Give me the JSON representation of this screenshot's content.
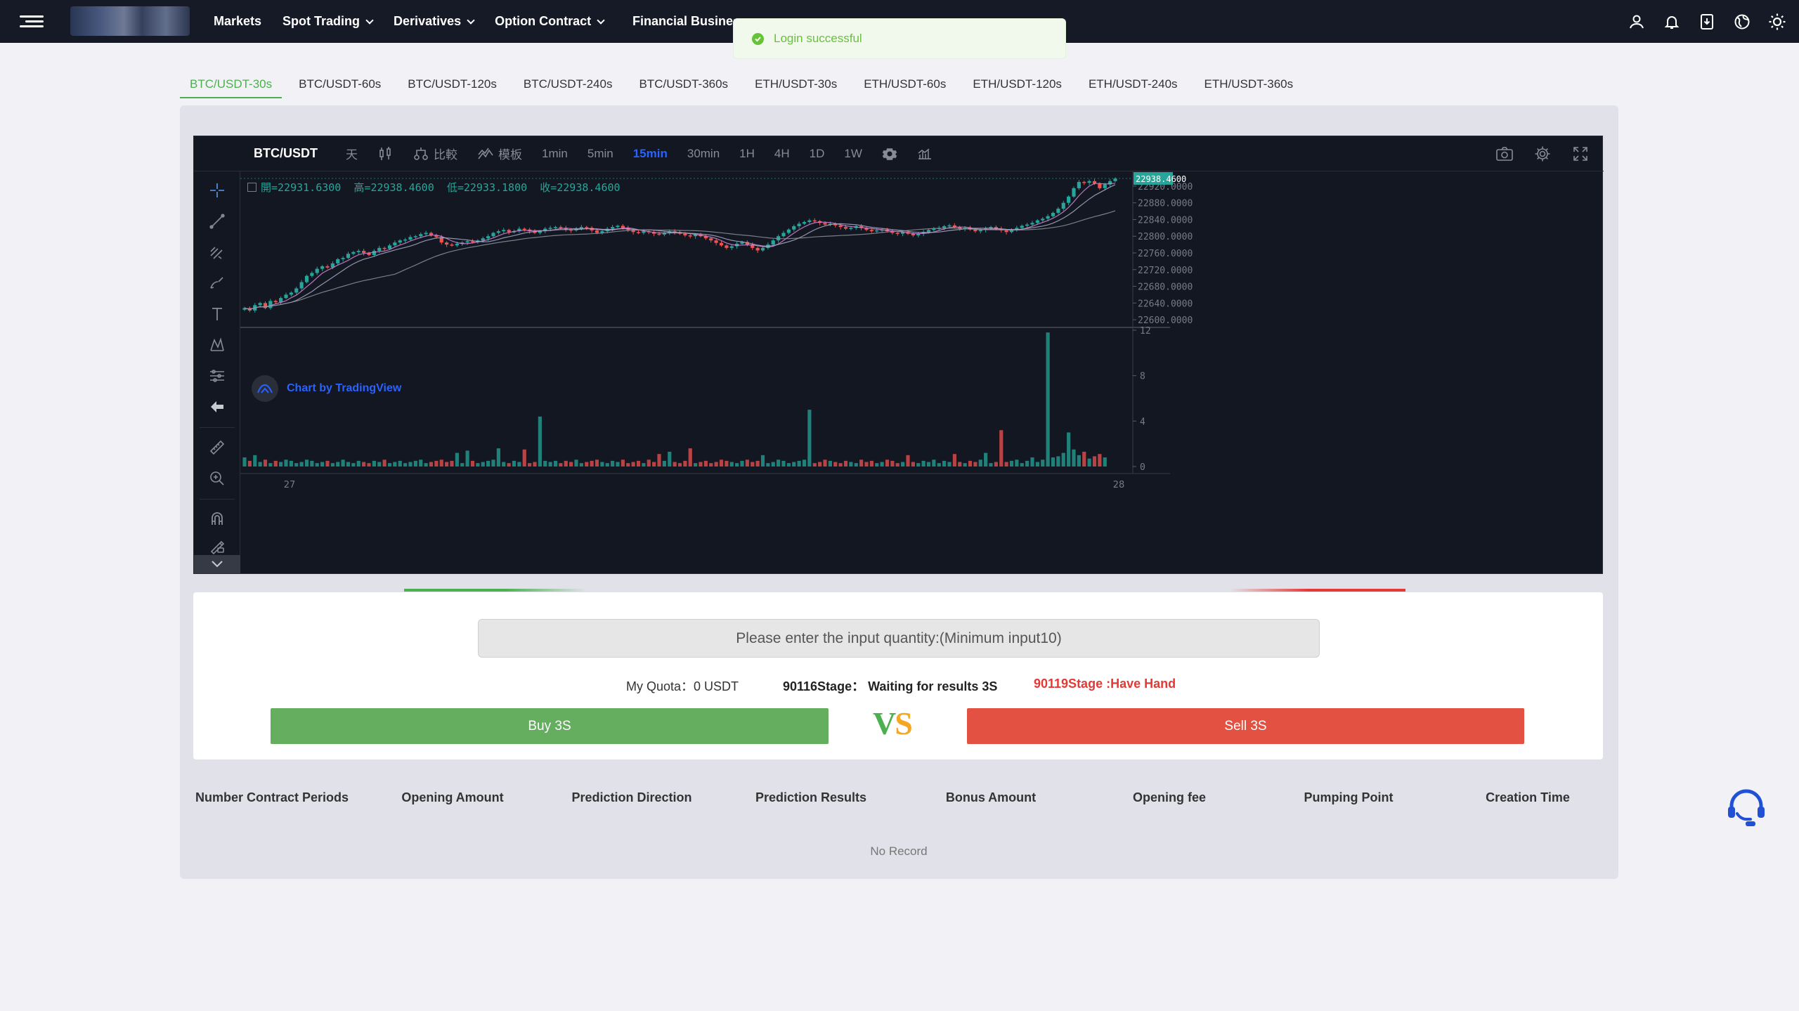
{
  "header": {
    "nav": [
      {
        "label": "Markets",
        "has_dropdown": false
      },
      {
        "label": "Spot Trading",
        "has_dropdown": true
      },
      {
        "label": "Derivatives",
        "has_dropdown": true
      },
      {
        "label": "Option Contract",
        "has_dropdown": true
      }
    ],
    "nav_clipped": "Financial Business",
    "icons": [
      "user-icon",
      "bell-icon",
      "download-icon",
      "globe-icon",
      "sun-icon"
    ]
  },
  "toast": {
    "message": "Login successful",
    "color": "#67c23a"
  },
  "tabs": {
    "items": [
      "BTC/USDT-30s",
      "BTC/USDT-60s",
      "BTC/USDT-120s",
      "BTC/USDT-240s",
      "BTC/USDT-360s",
      "ETH/USDT-30s",
      "ETH/USDT-60s",
      "ETH/USDT-120s",
      "ETH/USDT-240s",
      "ETH/USDT-360s"
    ],
    "active_index": 0
  },
  "chart": {
    "symbol": "BTC/USDT",
    "toolbar": {
      "day": "天",
      "compare": "比較",
      "template": "模板",
      "intervals": [
        "1min",
        "5min",
        "15min",
        "30min",
        "1H",
        "4H",
        "1D",
        "1W"
      ],
      "active_interval": "15min"
    },
    "ohlc": {
      "open_label": "開=",
      "open": "22931.6300",
      "high_label": "高=",
      "high": "22938.4600",
      "low_label": "低=",
      "low": "22933.1800",
      "close_label": "收=",
      "close": "22938.4600"
    },
    "branding": "Chart by TradingView",
    "colors": {
      "up": "#26a69a",
      "down": "#ef5350",
      "background": "#131722",
      "active": "#2962ff"
    }
  },
  "chart_data": {
    "type": "candlestick",
    "title": "BTC/USDT",
    "interval": "15min",
    "price_axis": {
      "ticks": [
        "22920.0000",
        "22880.0000",
        "22840.0000",
        "22800.0000",
        "22760.0000",
        "22720.0000",
        "22680.0000",
        "22640.0000",
        "22600.0000"
      ],
      "last_price": "22938.4600",
      "ylim": [
        22585,
        22935
      ]
    },
    "volume_axis": {
      "ticks": [
        "12",
        "8",
        "4",
        "0"
      ],
      "ylim": [
        0,
        12
      ]
    },
    "x_ticks": [
      "27",
      "28"
    ],
    "close_series": [
      22628,
      22622,
      22635,
      22640,
      22628,
      22645,
      22642,
      22652,
      22660,
      22665,
      22675,
      22690,
      22705,
      22712,
      22722,
      22728,
      22725,
      22735,
      22745,
      22748,
      22758,
      22762,
      22765,
      22760,
      22755,
      22765,
      22772,
      22770,
      22778,
      22785,
      22790,
      22792,
      22798,
      22800,
      22805,
      22808,
      22802,
      22798,
      22785,
      22780,
      22778,
      22782,
      22785,
      22788,
      22786,
      22790,
      22795,
      22800,
      22808,
      22812,
      22815,
      22810,
      22812,
      22818,
      22816,
      22812,
      22808,
      22812,
      22818,
      22820,
      22822,
      22820,
      22816,
      22814,
      22818,
      22822,
      22820,
      22814,
      22808,
      22812,
      22818,
      22822,
      22825,
      22820,
      22815,
      22810,
      22808,
      22812,
      22810,
      22806,
      22804,
      22808,
      22812,
      22810,
      22806,
      22802,
      22800,
      22804,
      22800,
      22795,
      22790,
      22784,
      22778,
      22772,
      22776,
      22782,
      22786,
      22780,
      22772,
      22766,
      22772,
      22780,
      22790,
      22800,
      22808,
      22816,
      22824,
      22830,
      22834,
      22838,
      22836,
      22832,
      22828,
      22830,
      22826,
      22822,
      22818,
      22820,
      22824,
      22820,
      22815,
      22812,
      22814,
      22816,
      22812,
      22808,
      22806,
      22810,
      22806,
      22802,
      22806,
      22810,
      22815,
      22818,
      22820,
      22824,
      22826,
      22822,
      22818,
      22820,
      22816,
      22812,
      22815,
      22818,
      22822,
      22818,
      22814,
      22810,
      22815,
      22820,
      22825,
      22828,
      22832,
      22838,
      22842,
      22848,
      22856,
      22866,
      22880,
      22895,
      22915,
      22930,
      22928,
      22932,
      22926,
      22915,
      22924,
      22932,
      22938
    ],
    "volume_series": [
      0.8,
      0.5,
      1.0,
      0.4,
      0.6,
      0.3,
      0.5,
      0.4,
      0.6,
      0.5,
      0.3,
      0.4,
      0.6,
      0.5,
      0.3,
      0.4,
      0.5,
      0.3,
      0.4,
      0.6,
      0.4,
      0.3,
      0.5,
      0.4,
      0.3,
      0.5,
      0.4,
      0.6,
      0.3,
      0.4,
      0.5,
      0.3,
      0.4,
      0.5,
      0.6,
      0.3,
      0.4,
      0.5,
      0.6,
      0.4,
      0.5,
      1.2,
      0.3,
      1.4,
      0.5,
      0.3,
      0.4,
      0.5,
      0.6,
      1.6,
      0.4,
      0.3,
      0.5,
      0.4,
      1.5,
      0.3,
      0.4,
      4.4,
      0.5,
      0.4,
      0.5,
      0.3,
      0.5,
      0.4,
      0.6,
      0.3,
      0.4,
      0.5,
      0.6,
      0.4,
      0.3,
      0.5,
      0.4,
      0.6,
      0.3,
      0.4,
      0.5,
      0.3,
      0.6,
      0.4,
      1.1,
      0.5,
      1.3,
      0.4,
      0.3,
      0.5,
      1.6,
      0.3,
      0.4,
      0.5,
      0.3,
      0.4,
      0.6,
      0.5,
      0.4,
      0.3,
      0.5,
      0.6,
      0.4,
      0.5,
      1.0,
      0.3,
      0.4,
      0.6,
      0.5,
      0.3,
      0.4,
      0.5,
      0.6,
      5.0,
      0.3,
      0.4,
      0.6,
      0.5,
      0.4,
      0.3,
      0.5,
      0.4,
      0.3,
      0.6,
      0.4,
      0.5,
      0.3,
      0.4,
      0.6,
      0.5,
      0.3,
      0.4,
      1.0,
      0.4,
      0.3,
      0.5,
      0.4,
      0.6,
      0.3,
      0.5,
      0.4,
      1.1,
      0.4,
      0.3,
      0.5,
      0.4,
      0.6,
      1.2,
      0.3,
      0.4,
      3.2,
      0.4,
      0.5,
      0.6,
      0.3,
      0.5,
      0.8,
      0.4,
      0.6,
      11.8,
      0.8,
      0.9,
      1.2,
      3.0,
      1.5,
      1.0,
      1.3,
      0.7,
      0.9,
      1.1,
      0.8
    ]
  },
  "trade": {
    "input_placeholder": "Please enter the input quantity:(Minimum input10)",
    "quota": "My Quota：0 USDT",
    "waiting": "90116Stage： Waiting for results 3S",
    "have_hand": "90119Stage :Have Hand",
    "buy_label": "Buy 3S",
    "sell_label": "Sell 3S",
    "vs_v": "V",
    "vs_s": "S",
    "colors": {
      "buy": "#65ad5f",
      "sell": "#e25142",
      "vs_v": "#4caf50",
      "vs_s": "#f5a623",
      "have_hand": "#e53935"
    }
  },
  "records": {
    "columns": [
      "Number Contract Periods",
      "Opening Amount",
      "Prediction Direction",
      "Prediction Results",
      "Bonus Amount",
      "Opening fee",
      "Pumping Point",
      "Creation Time"
    ],
    "empty_text": "No Record"
  }
}
